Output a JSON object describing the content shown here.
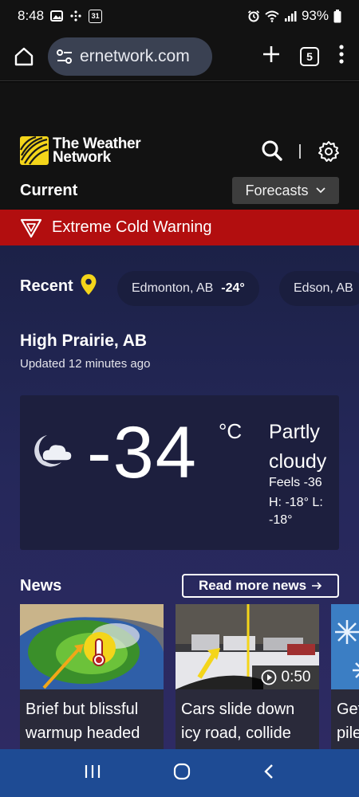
{
  "status_bar": {
    "time": "8:48",
    "calendar_day": "31",
    "battery": "93%"
  },
  "browser": {
    "url": "ernetwork.com",
    "tab_count": "5"
  },
  "header": {
    "logo_line1": "The Weather",
    "logo_line2": "Network",
    "current_label": "Current",
    "forecasts_label": "Forecasts"
  },
  "warning": {
    "text": "Extreme Cold Warning"
  },
  "recent": {
    "label": "Recent",
    "chips": [
      {
        "city": "Edmonton, AB",
        "temp": "-24°"
      },
      {
        "city": "Edson, AB",
        "temp": ""
      }
    ]
  },
  "location": {
    "name": "High Prairie, AB",
    "updated": "Updated 12 minutes ago"
  },
  "current": {
    "temp": "-34",
    "unit": "°C",
    "condition": "Partly cloudy",
    "feels_like": "Feels -36",
    "hilo": "H: -18°   L: -18°"
  },
  "news": {
    "label": "News",
    "read_more": "Read more news",
    "items": [
      {
        "title": "Brief but blissful warmup headed for the Prairies"
      },
      {
        "title": "Cars slide down icy road, collide with",
        "duration": "0:50"
      },
      {
        "title": "Get piled"
      }
    ]
  },
  "colors": {
    "warning_red": "#b20e0f",
    "logo_yellow": "#f4d51a",
    "nav_blue": "#1e4b94"
  }
}
